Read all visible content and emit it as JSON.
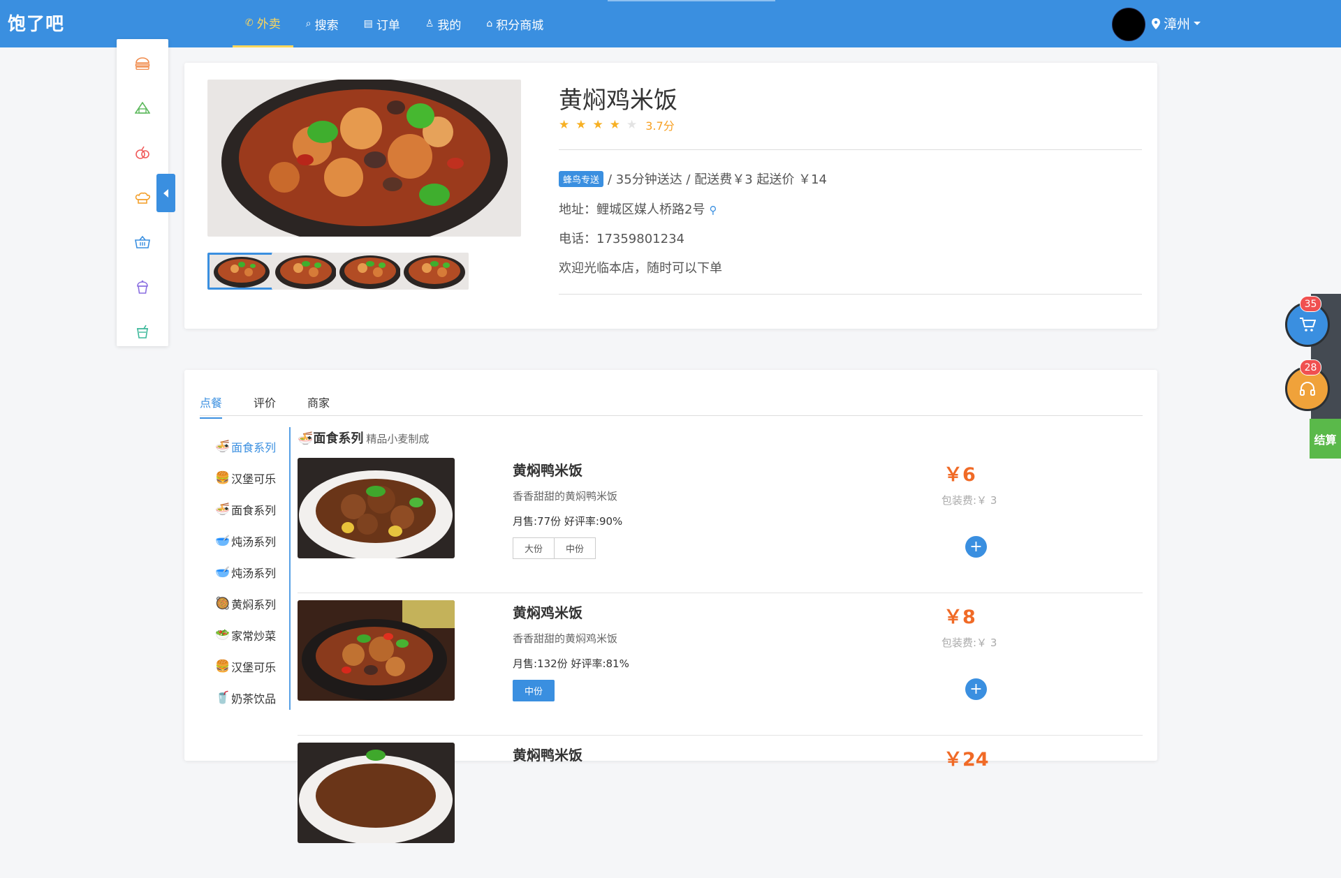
{
  "brand": "饱了吧",
  "nav": [
    {
      "icon": "compass-icon",
      "glyph": "✆",
      "label": "外卖"
    },
    {
      "icon": "search-icon",
      "glyph": "⌕",
      "label": "搜索"
    },
    {
      "icon": "order-icon",
      "glyph": "▤",
      "label": "订单"
    },
    {
      "icon": "user-icon",
      "glyph": "♙",
      "label": "我的"
    },
    {
      "icon": "shop-icon",
      "glyph": "⌂",
      "label": "积分商城"
    }
  ],
  "location": {
    "city": "漳州"
  },
  "colors": {
    "primary": "#3a8fe0",
    "price": "#f06a26",
    "star": "#f7b023",
    "checkout": "#5ab94a",
    "service": "#f0a23a"
  },
  "shop": {
    "name": "黄焖鸡米饭",
    "rating": 3.7,
    "score_text": "3.7分",
    "stars_total": 5,
    "delivery_badge": "蜂鸟专送",
    "delivery_text": "/ 35分钟送达 / 配送费￥3 起送价 ￥14",
    "address": "地址：鲤城区媒人桥路2号",
    "phone": "电话：17359801234",
    "notice": "欢迎光临本店，随时可以下单"
  },
  "tabs": [
    "点餐",
    "评价",
    "商家"
  ],
  "categories": [
    {
      "icon": "noodle-icon",
      "label": "面食系列"
    },
    {
      "icon": "burger-icon",
      "label": "汉堡可乐"
    },
    {
      "icon": "noodle-icon",
      "label": "面食系列"
    },
    {
      "icon": "soup-icon",
      "label": "炖汤系列"
    },
    {
      "icon": "soup-icon",
      "label": "炖汤系列"
    },
    {
      "icon": "stew-icon",
      "label": "黄焖系列"
    },
    {
      "icon": "vegetable-icon",
      "label": "家常炒菜"
    },
    {
      "icon": "burger-icon",
      "label": "汉堡可乐"
    },
    {
      "icon": "milktea-icon",
      "label": "奶茶饮品"
    }
  ],
  "section": {
    "title": "面食系列",
    "subtitle": "精品小麦制成"
  },
  "dishes": [
    {
      "name": "黄焖鸭米饭",
      "desc": "香香甜甜的黄焖鸭米饭",
      "sales": "月售:77份 好评率:90%",
      "specs": [
        "大份",
        "中份"
      ],
      "price": "￥6",
      "pack": "包装费:￥ 3"
    },
    {
      "name": "黄焖鸡米饭",
      "desc": "香香甜甜的黄焖鸡米饭",
      "sales": "月售:132份 好评率:81%",
      "specs": [
        "中份"
      ],
      "price": "￥8",
      "pack": "包装费:￥ 3"
    },
    {
      "name": "黄焖鸭米饭",
      "desc": "",
      "sales": "",
      "specs": [],
      "price": "￥24",
      "pack": ""
    }
  ],
  "float": {
    "cart_count": "35",
    "service_count": "28",
    "checkout": "结算"
  }
}
